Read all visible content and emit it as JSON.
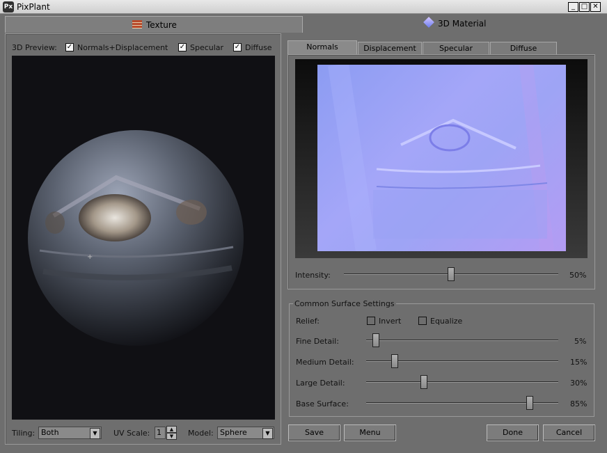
{
  "window": {
    "title": "PixPlant",
    "app_icon": "Px"
  },
  "main_tabs": {
    "texture": "Texture",
    "material": "3D Material"
  },
  "preview": {
    "label": "3D Preview:",
    "normals_disp": "Normals+Displacement",
    "specular": "Specular",
    "diffuse": "Diffuse"
  },
  "bottom_left": {
    "tiling_label": "Tiling:",
    "tiling_value": "Both",
    "uvscale_label": "UV Scale:",
    "uvscale_value": "1",
    "model_label": "Model:",
    "model_value": "Sphere"
  },
  "map_tabs": [
    "Normals",
    "Displacement",
    "Specular",
    "Diffuse"
  ],
  "intensity": {
    "label": "Intensity:",
    "value_text": "50%",
    "value": 0.5
  },
  "surface": {
    "title": "Common Surface Settings",
    "relief_label": "Relief:",
    "invert": "Invert",
    "equalize": "Equalize",
    "sliders": [
      {
        "label": "Fine Detail:",
        "value_text": "5%",
        "value": 0.05
      },
      {
        "label": "Medium Detail:",
        "value_text": "15%",
        "value": 0.15
      },
      {
        "label": "Large Detail:",
        "value_text": "30%",
        "value": 0.3
      },
      {
        "label": "Base Surface:",
        "value_text": "85%",
        "value": 0.85
      }
    ]
  },
  "buttons": {
    "save": "Save",
    "menu": "Menu",
    "done": "Done",
    "cancel": "Cancel"
  }
}
